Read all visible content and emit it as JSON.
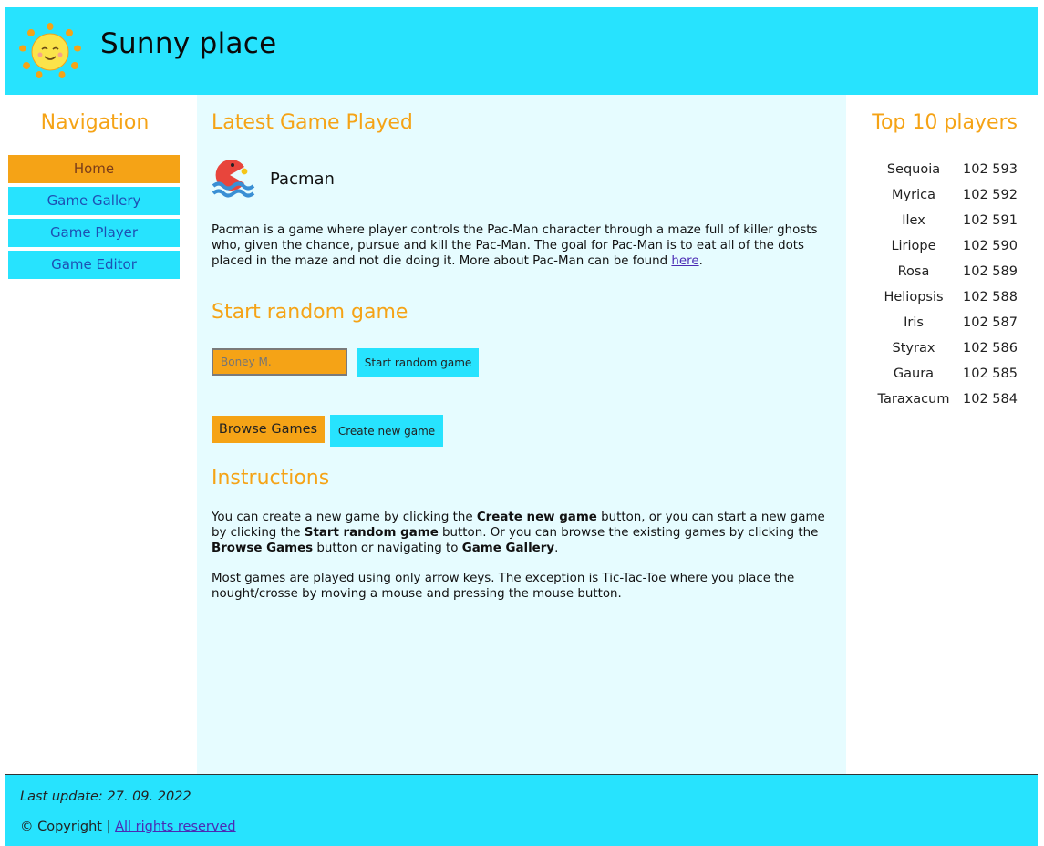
{
  "header": {
    "title": "Sunny place",
    "logo_icon": "sun-icon"
  },
  "nav": {
    "title": "Navigation",
    "items": [
      {
        "label": "Home",
        "active": true
      },
      {
        "label": "Game Gallery",
        "active": false
      },
      {
        "label": "Game Player",
        "active": false
      },
      {
        "label": "Game Editor",
        "active": false
      }
    ]
  },
  "main": {
    "latest_title": "Latest Game Played",
    "game_icon": "pacman-icon",
    "game_name": "Pacman",
    "description": "Pacman is a game where player controls the Pac-Man character through a maze full of killer ghosts who, given the chance, pursue and kill the Pac-Man. The goal for Pac-Man is to eat all of the dots placed in the maze and not die doing it. More about Pac-Man can be found",
    "description_link": "here",
    "random_title": "Start random game",
    "name_placeholder": "Boney M.",
    "start_random_button": "Start random game",
    "browse_button": "Browse Games",
    "create_button": "Create new game",
    "instructions_title": "Instructions",
    "instructions": {
      "p1_a": "You can create a new game by clicking the ",
      "p1_b": "Create new game",
      "p1_c": " button, or you can start a new game by clicking the ",
      "p1_d": "Start random game",
      "p1_e": " button. Or you can browse the existing games by clicking the ",
      "p1_f": "Browse Games",
      "p1_g": " button or navigating to ",
      "p1_h": "Game Gallery",
      "p1_i": ".",
      "p2": "Most games are played using only arrow keys. The exception is Tic-Tac-Toe where you place the nought/crosse by moving a mouse and pressing the mouse button."
    }
  },
  "top_players": {
    "title": "Top 10 players",
    "players": [
      {
        "name": "Sequoia",
        "score": "102 593"
      },
      {
        "name": "Myrica",
        "score": "102 592"
      },
      {
        "name": "Ilex",
        "score": "102 591"
      },
      {
        "name": "Liriope",
        "score": "102 590"
      },
      {
        "name": "Rosa",
        "score": "102 589"
      },
      {
        "name": "Heliopsis",
        "score": "102 588"
      },
      {
        "name": "Iris",
        "score": "102 587"
      },
      {
        "name": "Styrax",
        "score": "102 586"
      },
      {
        "name": "Gaura",
        "score": "102 585"
      },
      {
        "name": "Taraxacum",
        "score": "102 584"
      }
    ]
  },
  "footer": {
    "last_update": "Last update: 27. 09. 2022",
    "copyright": "© Copyright |",
    "rights_link": "All rights reserved"
  },
  "colors": {
    "accent_cyan": "#27e3fe",
    "accent_orange": "#f5a316",
    "main_bg": "#e6fcff"
  }
}
